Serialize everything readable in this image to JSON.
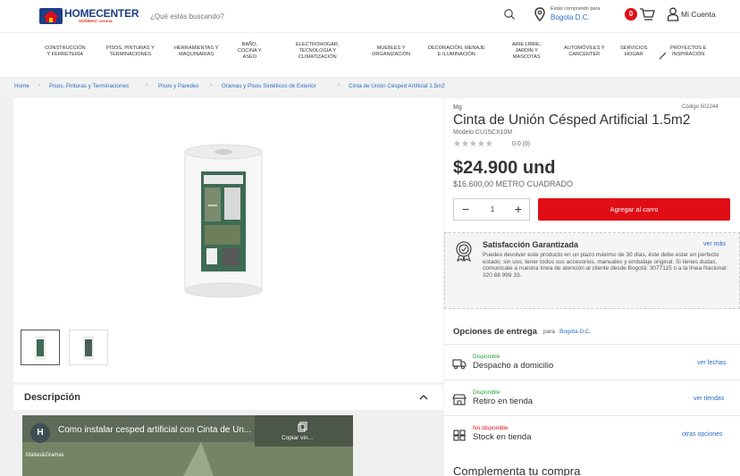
{
  "header": {
    "logo_text": "HOMECENTER",
    "logo_sub": "SODIMAC corona",
    "search_placeholder": "¿Qué estás buscando?",
    "location_label": "Estás comprando para",
    "location_city": "Bogota D.C.",
    "cart_count": "0",
    "account_label": "Mi Cuenta"
  },
  "categories": [
    {
      "line1": "Construcción",
      "line2": "y ferretería"
    },
    {
      "line1": "Pisos, pinturas y",
      "line2": "terminaciones"
    },
    {
      "line1": "Herramientas y",
      "line2": "maquinarias"
    },
    {
      "line1": "Baño,",
      "line2": "cocina y",
      "line3": "aseo"
    },
    {
      "line1": "Electrohogar,",
      "line2": "tecnología y",
      "line3": "climatización"
    },
    {
      "line1": "Muebles y",
      "line2": "organización"
    },
    {
      "line1": "Decoración, menaje",
      "line2": "e iluminación"
    },
    {
      "line1": "Aire libre,",
      "line2": "jardín y",
      "line3": "mascotas"
    },
    {
      "line1": "Automóviles y",
      "line2": "carcenter"
    },
    {
      "line1": "Servicios",
      "line2": "hogar"
    },
    {
      "line1": "Proyectos e",
      "line2": "inspiración"
    }
  ],
  "breadcrumb": [
    "Home",
    "Pisos, Pinturas y Terminaciones",
    "Pisos y Paredes",
    "Gramas y Pisos Sintéticos de Exterior",
    "Cinta de Unión Césped Artificial 1.5m2"
  ],
  "product": {
    "brand": "Mg",
    "code": "Código 502244",
    "title": "Cinta de Unión Césped Artificial 1.5m2",
    "model": "Modelo CU15CX10M",
    "stars": "★★★★★",
    "rating": "0.0 (0)",
    "price": "$24.900 und",
    "unit_price": "$16.600,00 METRO CUADRADO",
    "qty_minus": "−",
    "qty_value": "1",
    "qty_plus": "+",
    "add_to_cart": "Agregar al carro"
  },
  "satisfaction": {
    "title": "Satisfacción Garantizada",
    "more": "ver más",
    "text": "Puedes devolver este producto en un plazo máximo de 30 días, éste debe estar en perfecto estado: sin uso, tener todos sus accesorios, manuales y embalaje original. Si tienes dudas, comunícate a nuestra línea de atención al cliente desde Bogotá: 3077115 o a la línea Nacional: 320 88 999 33."
  },
  "delivery": {
    "title": "Opciones de entrega",
    "for_label": "para",
    "city": "Bogota D.C.",
    "options": [
      {
        "status": "Disponible",
        "label": "Despacho a domicilio",
        "link": "ver fechas",
        "status_color": "#2e9e3e"
      },
      {
        "status": "Disponible",
        "label": "Retiro en tienda",
        "link": "ver tiendas",
        "status_color": "#2e9e3e"
      },
      {
        "status": "No disponible",
        "label": "Stock en tienda",
        "link": "otras opciones",
        "status_color": "#e10d16"
      }
    ]
  },
  "complement_title": "Complementa tu compra",
  "description": {
    "title": "Descripción",
    "video_avatar": "H",
    "video_title": "Como instalar cesped artificial con Cinta de Un...",
    "video_copy": "Copiar vín...",
    "video_channel": "Mallas&Gramas"
  },
  "colors": {
    "accent_red": "#e10d16",
    "link_blue": "#2a6bc7",
    "brand_navy": "#1d3e87"
  }
}
